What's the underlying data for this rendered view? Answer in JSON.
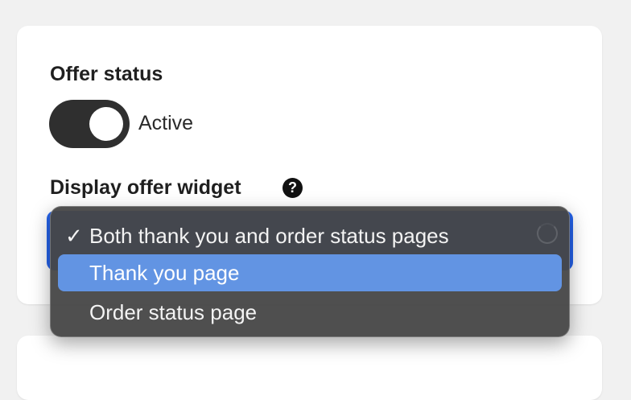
{
  "offer_status": {
    "title": "Offer status",
    "toggle_label": "Active",
    "toggle_on": true
  },
  "display_widget": {
    "title": "Display offer widget",
    "help_icon": "question-circle-icon",
    "options": [
      {
        "label": "Both thank you and order status pages",
        "checked": true
      },
      {
        "label": "Thank you page",
        "checked": false,
        "highlighted": true
      },
      {
        "label": "Order status page",
        "checked": false
      }
    ],
    "check_mark": "✓"
  },
  "colors": {
    "toggle_bg": "#2f2f2f",
    "select_accent": "#2563eb",
    "highlight": "#6294e3",
    "popup_bg": "#464646"
  }
}
